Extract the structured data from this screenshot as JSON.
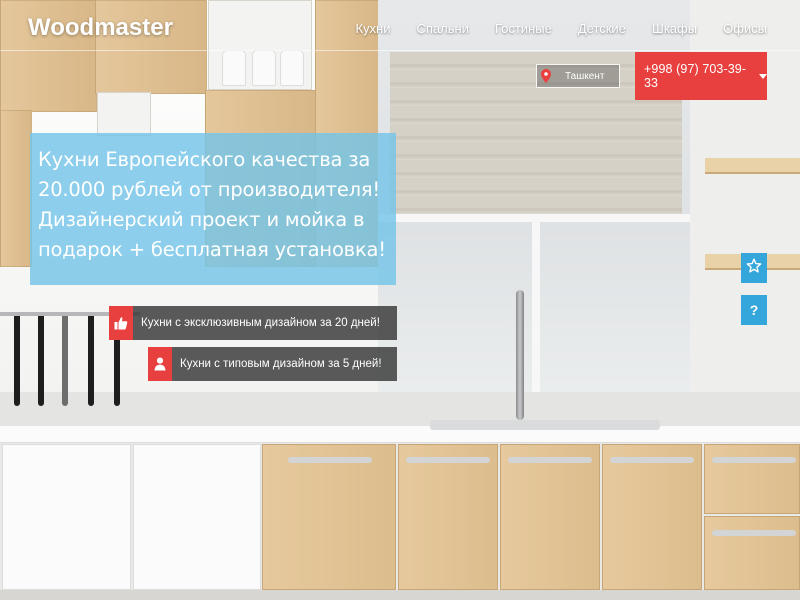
{
  "brand": {
    "logo": "Woodmaster"
  },
  "nav": [
    "Кухни",
    "Спальни",
    "Гостиные",
    "Детские",
    "Шкафы",
    "Офисы"
  ],
  "location": {
    "city": "Ташкент"
  },
  "contact": {
    "phone": "+998 (97) 703-39-33"
  },
  "hero": {
    "lines": [
      "Кухни Европейского качества за",
      "20.000 рублей от производителя!",
      "Дизайнерский проект и мойка в",
      "подарок + бесплатная установка!"
    ]
  },
  "offers": [
    {
      "text": "Кухни с эксклюзивным дизайном за 20 дней!",
      "icon": "thumbs-up-icon"
    },
    {
      "text": "Кухни с типовым дизайном за 5 дней!",
      "icon": "person-icon"
    }
  ],
  "colors": {
    "accent_red": "#e8403f",
    "accent_blue": "#35a6dc",
    "hero_overlay": "#74c4e8"
  }
}
